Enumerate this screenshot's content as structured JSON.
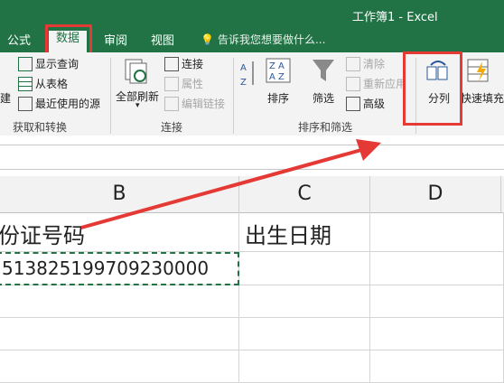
{
  "window": {
    "title": "工作簿1 - Excel"
  },
  "tabs": [
    {
      "label": "公式"
    },
    {
      "label": "数据"
    },
    {
      "label": "审阅"
    },
    {
      "label": "视图"
    }
  ],
  "tell_me": "告诉我您想要做什么...",
  "ribbon": {
    "get_transform": {
      "items": [
        "显示查询",
        "从表格",
        "最近使用的源"
      ],
      "partial_label": "建",
      "label": "获取和转换"
    },
    "connections": {
      "refresh_all": "全部刷新",
      "items": [
        "连接",
        "属性",
        "编辑链接"
      ],
      "label": "连接"
    },
    "sort_filter": {
      "sort": "排序",
      "filter": "筛选",
      "items": [
        "清除",
        "重新应用",
        "高级"
      ],
      "label": "排序和筛选"
    },
    "data_tools": {
      "text_to_columns": "分列",
      "flash_fill": "快速填充"
    }
  },
  "sheet": {
    "columns": [
      "B",
      "C",
      "D"
    ],
    "rows": [
      {
        "b": "份证号码",
        "c": "出生日期",
        "d": ""
      },
      {
        "b": "513825199709230000",
        "c": "",
        "d": ""
      }
    ]
  },
  "colors": {
    "excel_green": "#217346",
    "highlight_red": "#e53935"
  }
}
